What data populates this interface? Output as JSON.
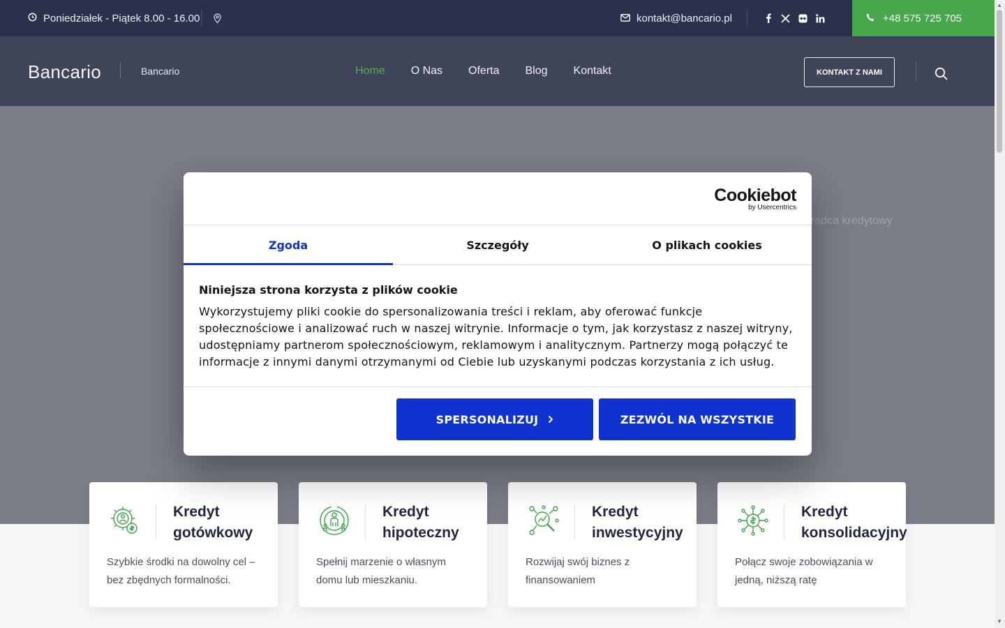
{
  "topbar": {
    "hours": "Poniedziałek - Piątek 8.00 - 16.00",
    "email": "kontakt@bancario.pl",
    "phone": "+48 575 725 705",
    "icons": [
      "clock-icon",
      "map-pin-icon",
      "mail-icon",
      "facebook-icon",
      "x-icon",
      "flickr-icon",
      "linkedin-icon",
      "phone-icon"
    ]
  },
  "header": {
    "logo": "Bancario",
    "tagline": "Bancario",
    "nav": [
      "Home",
      "O Nas",
      "Oferta",
      "Blog",
      "Kontakt"
    ],
    "active_nav": "Home",
    "cta": "KONTAKT Z NAMI"
  },
  "hero": {
    "caption": "radca kredytowy"
  },
  "cards": [
    {
      "title": "Kredyt gotówkowy",
      "desc": "Szybkie środki na dowolny cel – bez zbędnych formalności.",
      "icon": "gear-person-icon"
    },
    {
      "title": "Kredyt hipoteczny",
      "desc": "Spełnij marzenie o własnym domu lub mieszkaniu.",
      "icon": "family-icon"
    },
    {
      "title": "Kredyt inwestycyjny",
      "desc": "Rozwijaj swój biznes z finansowaniem",
      "icon": "analytics-icon"
    },
    {
      "title": "Kredyt konsolidacyjny",
      "desc": "Połącz swoje zobowiązania w jedną, niższą ratę",
      "icon": "network-dollar-icon"
    }
  ],
  "cookie": {
    "brand": "Cookiebot",
    "brand_sub": "by Usercentrics",
    "tabs": [
      "Zgoda",
      "Szczegóły",
      "O plikach cookies"
    ],
    "active_tab": "Zgoda",
    "heading": "Niniejsza strona korzysta z plików cookie",
    "body": "Wykorzystujemy pliki cookie do spersonalizowania treści i reklam, aby oferować funkcje społecznościowe i analizować ruch w naszej witrynie. Informacje o tym, jak korzystasz z naszej witryny, udostępniamy partnerom społecznościowym, reklamowym i analitycznym. Partnerzy mogą połączyć te informacje z innymi danymi otrzymanymi od Ciebie lub uzyskanymi podczas korzystania z ich usług.",
    "btn_customize": "SPERSONALIZUJ",
    "btn_allow": "ZEZWÓL NA WSZYSTKIE"
  },
  "colors": {
    "topbar": "#2b314a",
    "header": "#3f4458",
    "accent_green": "#46a84a",
    "cookie_blue": "#1032cf"
  }
}
